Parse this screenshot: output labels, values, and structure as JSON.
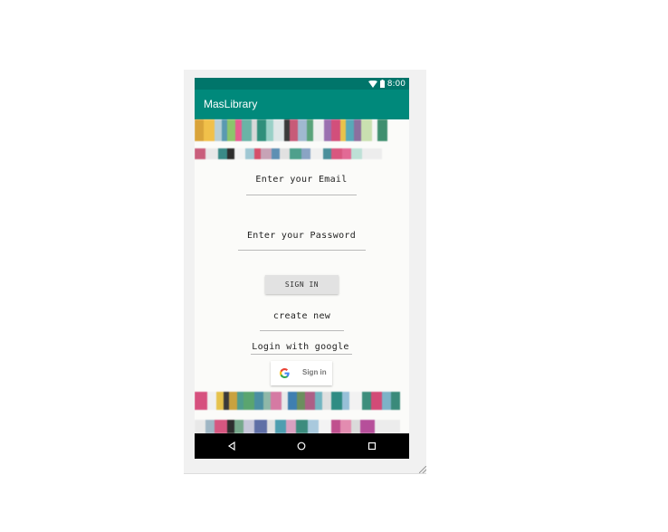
{
  "statusbar": {
    "time": "8:00",
    "wifi_icon": "wifi-icon",
    "battery_icon": "battery-icon"
  },
  "appbar": {
    "title": "MasLibrary"
  },
  "form": {
    "email_hint": "Enter your Email",
    "password_hint": "Enter your Password",
    "signin_label": "SIGN IN",
    "create_new_label": "create new",
    "login_google_label": "Login with google",
    "google_signin_label": "Sign in"
  },
  "navbar": {
    "back_icon": "back-triangle-icon",
    "home_icon": "home-circle-icon",
    "recents_icon": "recents-square-icon"
  },
  "colors": {
    "statusbar": "#00756a",
    "appbar": "#00897b",
    "navbar": "#000000"
  }
}
